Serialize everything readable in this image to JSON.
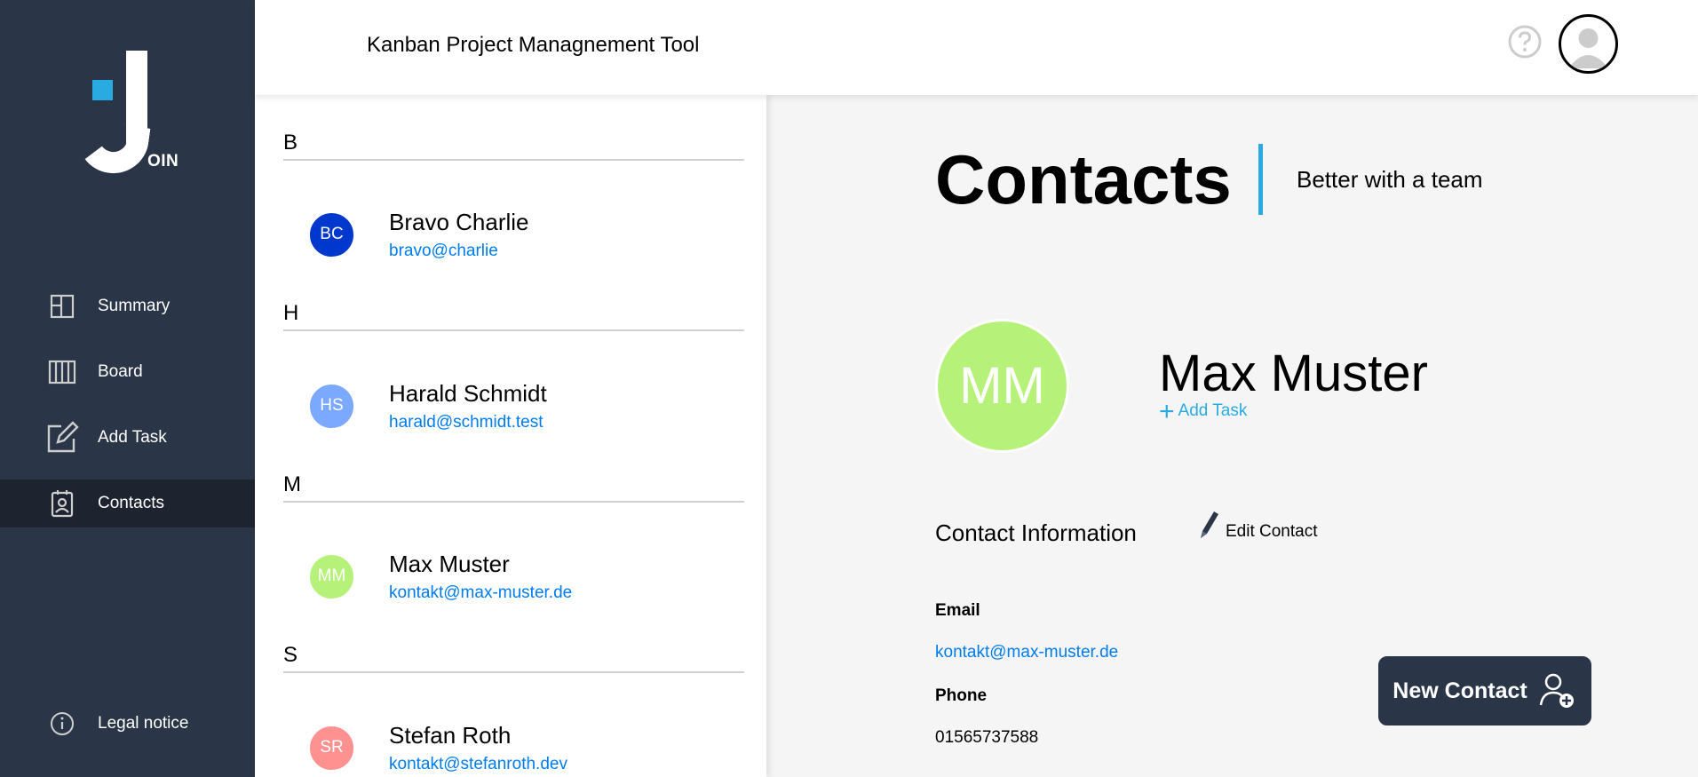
{
  "app": {
    "logo_text": "OIN",
    "header_title": "Kanban Project Managnement Tool"
  },
  "nav": {
    "items": [
      {
        "label": "Summary",
        "icon": "summary-icon"
      },
      {
        "label": "Board",
        "icon": "board-icon"
      },
      {
        "label": "Add Task",
        "icon": "edit-icon"
      },
      {
        "label": "Contacts",
        "icon": "contacts-icon",
        "active": true
      }
    ],
    "legal": {
      "label": "Legal notice",
      "icon": "info-icon"
    }
  },
  "contact_list": {
    "groups": [
      {
        "letter": "B",
        "contacts": [
          {
            "initials": "BC",
            "name": "Bravo Charlie",
            "email": "bravo@charlie",
            "color": "#0038ce"
          }
        ]
      },
      {
        "letter": "H",
        "contacts": [
          {
            "initials": "HS",
            "name": "Harald Schmidt",
            "email": "harald@schmidt.test",
            "color": "#7aa9ff"
          }
        ]
      },
      {
        "letter": "M",
        "contacts": [
          {
            "initials": "MM",
            "name": "Max Muster",
            "email": "kontakt@max-muster.de",
            "color": "#b6f27a"
          }
        ]
      },
      {
        "letter": "S",
        "contacts": [
          {
            "initials": "SR",
            "name": "Stefan Roth",
            "email": "kontakt@stefanroth.dev",
            "color": "#ff9191"
          }
        ]
      }
    ]
  },
  "main": {
    "title": "Contacts",
    "subtitle": "Better with a team",
    "selected": {
      "initials": "MM",
      "name": "Max Muster",
      "add_task_label": "Add Task",
      "add_task_symbol": "+",
      "info_title": "Contact Information",
      "edit_label": "Edit Contact",
      "email_label": "Email",
      "email": "kontakt@max-muster.de",
      "phone_label": "Phone",
      "phone": "01565737588",
      "color": "#b6f27a"
    },
    "new_contact_label": "New Contact"
  },
  "colors": {
    "sidebar": "#2a3647",
    "sidebar_active": "#1d2430",
    "accent": "#29abe2",
    "link": "#007cee"
  }
}
